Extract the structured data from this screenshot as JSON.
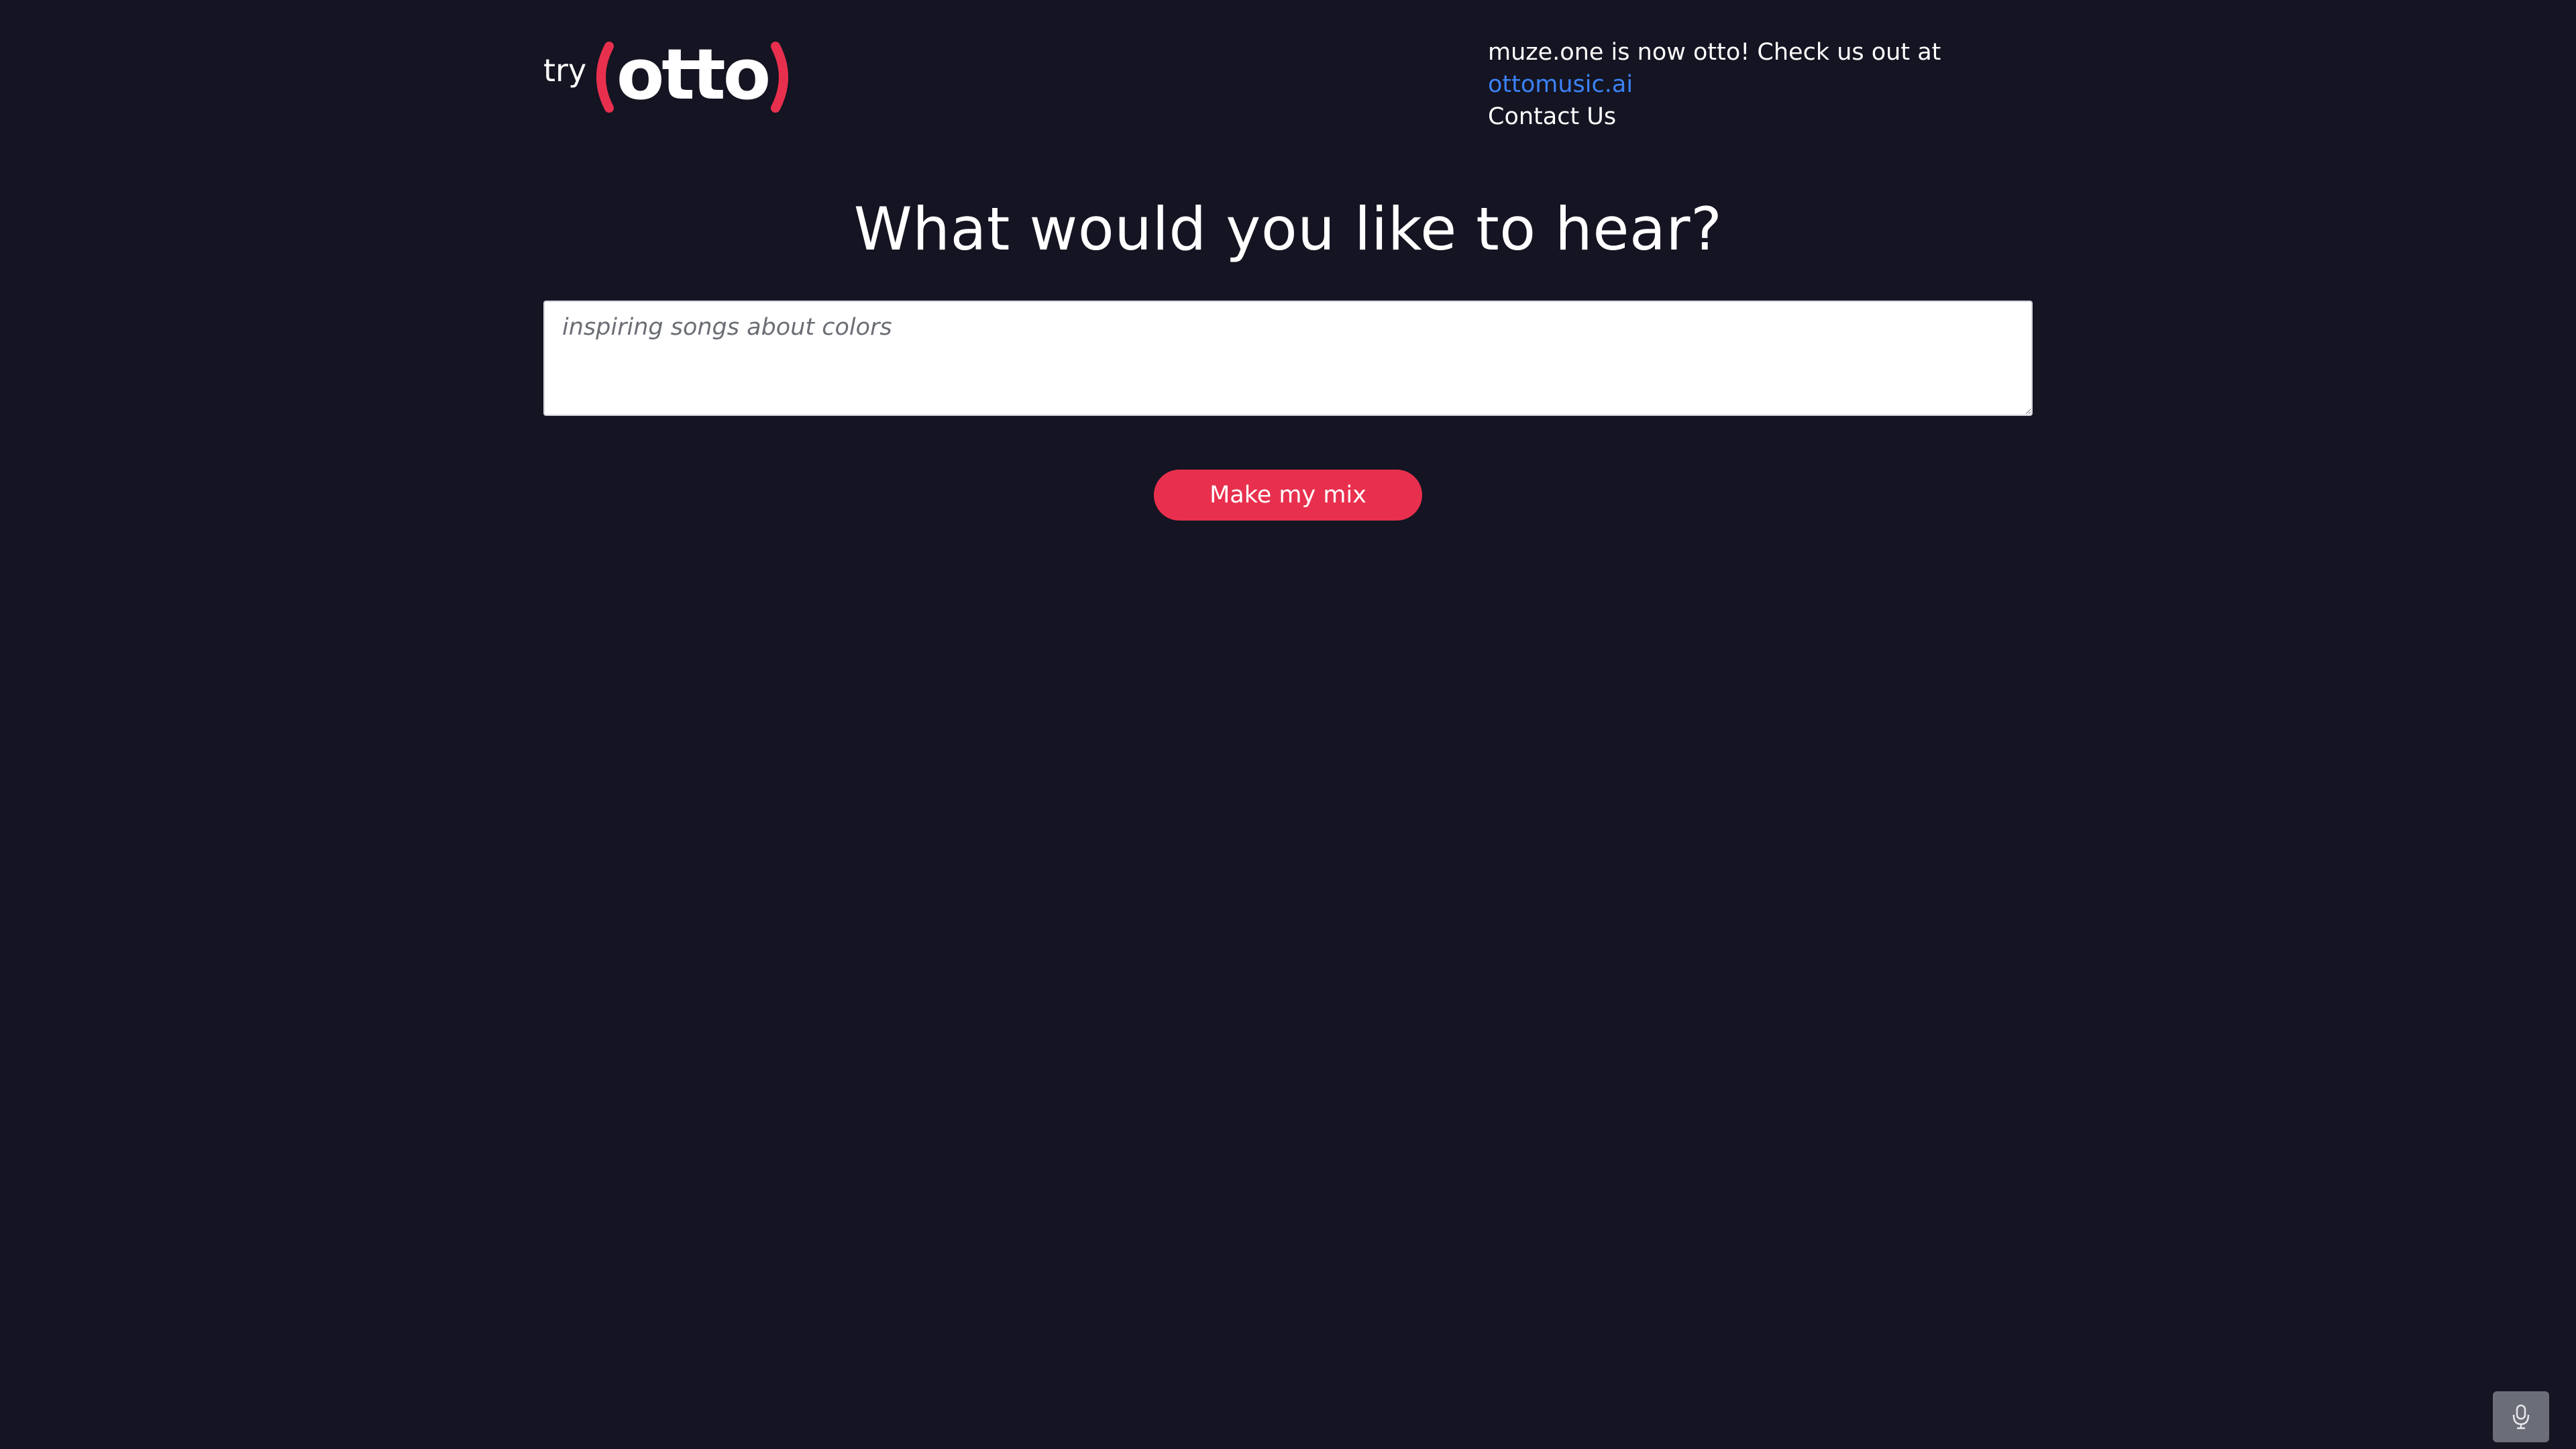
{
  "logo": {
    "prefix": "try",
    "brand": "otto",
    "brand_color": "#e8304e"
  },
  "notice": {
    "text": "muze.one is now otto! Check us out at ",
    "link_text": "ottomusic.ai",
    "link_color": "#3b82f6",
    "contact_label": "Contact Us"
  },
  "main": {
    "title": "What would you like to hear?",
    "prompt_placeholder": "inspiring songs about colors",
    "prompt_value": "",
    "submit_label": "Make my mix",
    "submit_color": "#e8304e"
  },
  "floating": {
    "mic_icon": "microphone-icon"
  },
  "colors": {
    "background": "#141422"
  }
}
